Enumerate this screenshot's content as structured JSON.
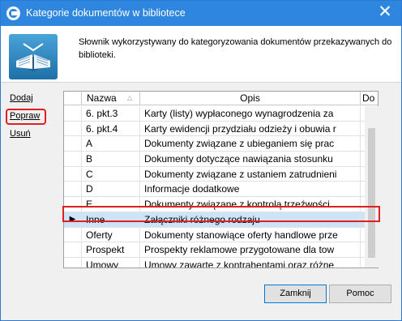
{
  "window": {
    "title": "Kategorie dokumentów w bibliotece",
    "close_glyph": "✕"
  },
  "header": {
    "description": "Słownik wykorzystywany do kategoryzowania dokumentów przekazywanych do biblioteki.",
    "icon": "book-icon"
  },
  "actions": {
    "add": "Dodaj",
    "edit": "Popraw",
    "delete": "Usuń"
  },
  "grid": {
    "columns": {
      "name": "Nazwa",
      "description": "Opis",
      "do": "Do"
    },
    "rows": [
      {
        "name": "6. pkt.3",
        "description": "Karty (listy) wypłaconego wynagrodzenia za",
        "check": ""
      },
      {
        "name": "6. pkt.4",
        "description": "Karty ewidencji przydziału odzieży i obuwia r",
        "check": ""
      },
      {
        "name": "A",
        "description": "Dokumenty związane z ubieganiem się prac",
        "check": ""
      },
      {
        "name": "B",
        "description": "Dokumenty dotyczące nawiązania stosunku",
        "check": ""
      },
      {
        "name": "C",
        "description": "Dokumenty związane z ustaniem zatrudnieni",
        "check": ""
      },
      {
        "name": "D",
        "description": "Informacje dodatkowe",
        "check": "✔"
      },
      {
        "name": "E",
        "description": "Dokumenty związane z kontrolą trzeźwości",
        "check": ""
      },
      {
        "name": "Inne",
        "description": "Załączniki różnego rodzaju",
        "check": ""
      },
      {
        "name": "Oferty",
        "description": "Dokumenty stanowiące oferty handlowe prze",
        "check": ""
      },
      {
        "name": "Prospekt",
        "description": "Prospekty reklamowe przygotowane dla tow",
        "check": ""
      },
      {
        "name": "Umowy",
        "description": "Umowy zawarte z kontrahentami oraz różne",
        "check": ""
      }
    ],
    "selected_row_marker": "▶"
  },
  "buttons": {
    "close": "Zamknij",
    "help": "Pomoc"
  },
  "colors": {
    "titlebar": "#2e86de",
    "highlight": "#e02020",
    "selection": "#cde4f7"
  }
}
